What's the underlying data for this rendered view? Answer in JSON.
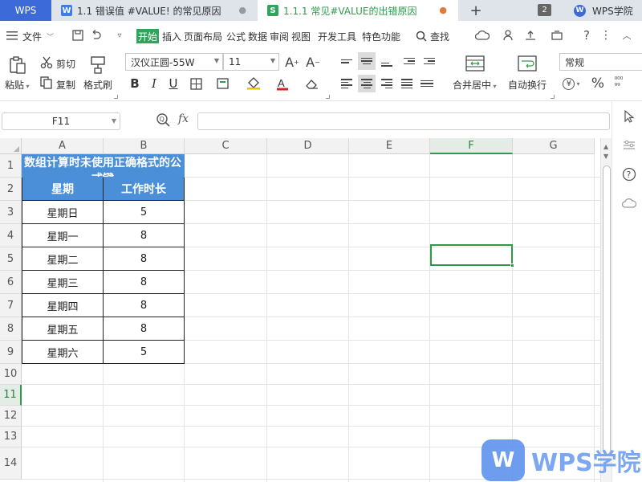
{
  "tabs": {
    "wps_home": "WPS",
    "doc1": "1.1 错误值 #VALUE! 的常见原因",
    "doc2": "1.1.1 常见#VALUE的出错原因",
    "add": "+",
    "window_count": "2",
    "academy": "WPS学院"
  },
  "menu": {
    "file": "文件",
    "items": [
      "开始",
      "插入",
      "页面布局",
      "公式",
      "数据",
      "审阅",
      "视图",
      "开发工具",
      "特色功能"
    ],
    "active_index": 0,
    "search": "查找"
  },
  "ribbon": {
    "paste": "粘贴",
    "cut": "剪切",
    "copy": "复制",
    "format_painter": "格式刷",
    "font_name": "汉仪正圆-55W",
    "font_size": "11",
    "merge_center": "合并居中",
    "wrap_text": "自动换行",
    "number_format": "常规",
    "currency_symbol": "¥",
    "percent_symbol": "%"
  },
  "formula_bar": {
    "name_box": "F11",
    "fx": "fx",
    "formula": ""
  },
  "sheet": {
    "columns": [
      "A",
      "B",
      "C",
      "D",
      "E",
      "F",
      "G"
    ],
    "rows": [
      "1",
      "2",
      "3",
      "4",
      "5",
      "6",
      "7",
      "8",
      "9",
      "10",
      "11",
      "12",
      "13",
      "14"
    ],
    "selected_column": "F",
    "selected_row": "11",
    "title": "数组计算时未使用正确格式的公式键",
    "headers": [
      "星期",
      "工作时长"
    ],
    "data": [
      [
        "星期日",
        "5"
      ],
      [
        "星期一",
        "8"
      ],
      [
        "星期二",
        "8"
      ],
      [
        "星期三",
        "8"
      ],
      [
        "星期四",
        "8"
      ],
      [
        "星期五",
        "8"
      ],
      [
        "星期六",
        "5"
      ]
    ]
  },
  "watermark": {
    "text": "WPS学院"
  },
  "colors": {
    "accent_green": "#2e9a4a",
    "header_blue": "#4b8fd8",
    "wps_blue": "#3c6ad8"
  }
}
